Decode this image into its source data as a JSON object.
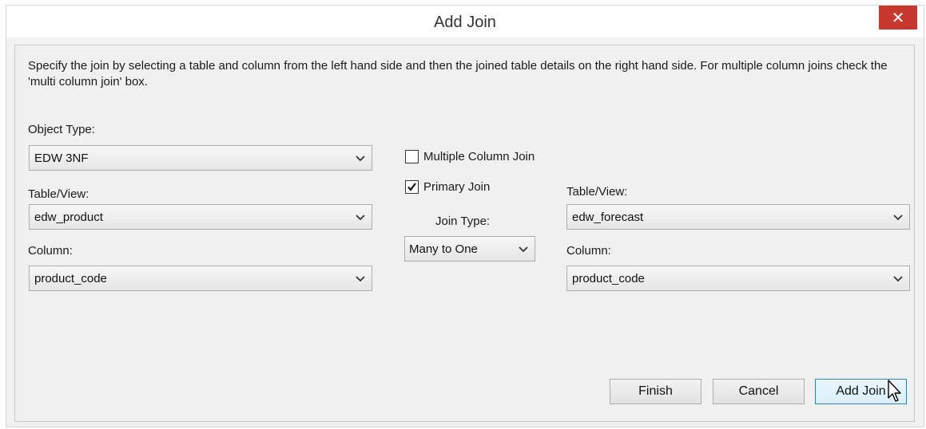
{
  "window": {
    "title": "Add Join",
    "close_glyph": "✕"
  },
  "instructions": "Specify the join by selecting a table and column from the left hand side and then the joined table details on the right hand side. For multiple column joins check the 'multi column join' box.",
  "left": {
    "object_type_label": "Object Type:",
    "object_type_value": "EDW 3NF",
    "table_label": "Table/View:",
    "table_value": "edw_product",
    "column_label": "Column:",
    "column_value": "product_code"
  },
  "middle": {
    "multi_column_label": "Multiple Column Join",
    "multi_column_checked": false,
    "primary_join_label": "Primary Join",
    "primary_join_checked": true,
    "join_type_label": "Join Type:",
    "join_type_value": "Many to One"
  },
  "right": {
    "table_label": "Table/View:",
    "table_value": "edw_forecast",
    "column_label": "Column:",
    "column_value": "product_code"
  },
  "buttons": {
    "finish": "Finish",
    "cancel": "Cancel",
    "add_join": "Add Join"
  },
  "colors": {
    "close_red": "#c7372d",
    "focus_blue": "#3c7fb1"
  }
}
